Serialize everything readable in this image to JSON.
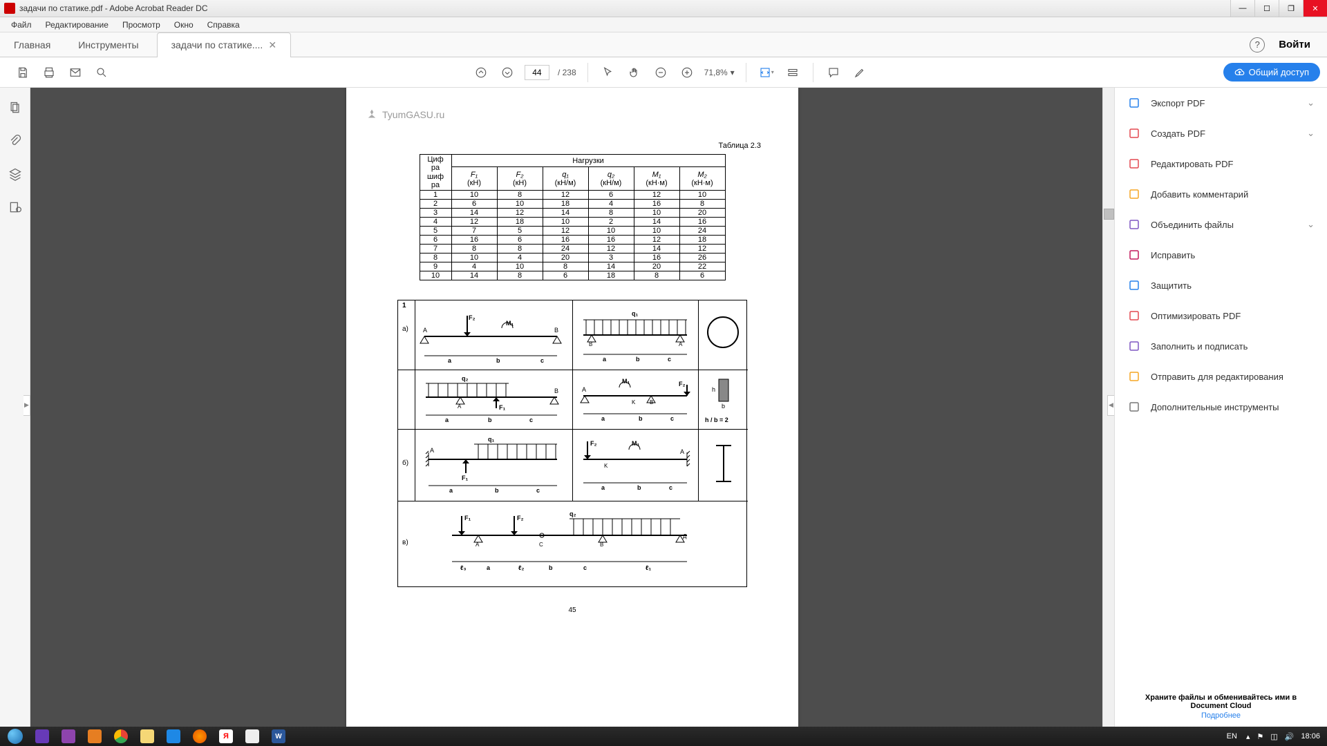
{
  "titlebar": {
    "text": "задачи по статике.pdf - Adobe Acrobat Reader DC"
  },
  "menu": [
    "Файл",
    "Редактирование",
    "Просмотр",
    "Окно",
    "Справка"
  ],
  "tabs": {
    "home": "Главная",
    "tools": "Инструменты",
    "doc": "задачи по статике...."
  },
  "login": "Войти",
  "toolbar": {
    "page": "44",
    "total": "/ 238",
    "zoom": "71,8%",
    "share": "Общий доступ"
  },
  "page": {
    "watermark": "TyumGASU.ru",
    "table_caption": "Таблица 2.3",
    "num": "45",
    "table": {
      "h0": "Циф\nра\nшиф\nра",
      "h_nagr": "Нагрузки",
      "cols": [
        {
          "sym": "F₁",
          "unit": "(кН)"
        },
        {
          "sym": "F₂",
          "unit": "(кН)"
        },
        {
          "sym": "q₁",
          "unit": "(кН/м)"
        },
        {
          "sym": "q₂",
          "unit": "(кН/м)"
        },
        {
          "sym": "M₁",
          "unit": "(кН·м)"
        },
        {
          "sym": "M₂",
          "unit": "(кН·м)"
        }
      ],
      "rows": [
        [
          "1",
          "10",
          "8",
          "12",
          "6",
          "12",
          "10"
        ],
        [
          "2",
          "6",
          "10",
          "18",
          "4",
          "16",
          "8"
        ],
        [
          "3",
          "14",
          "12",
          "14",
          "8",
          "10",
          "20"
        ],
        [
          "4",
          "12",
          "18",
          "10",
          "2",
          "14",
          "16"
        ],
        [
          "5",
          "7",
          "5",
          "12",
          "10",
          "10",
          "24"
        ],
        [
          "6",
          "16",
          "6",
          "16",
          "16",
          "12",
          "18"
        ],
        [
          "7",
          "8",
          "8",
          "24",
          "12",
          "14",
          "12"
        ],
        [
          "8",
          "10",
          "4",
          "20",
          "3",
          "16",
          "26"
        ],
        [
          "9",
          "4",
          "10",
          "8",
          "14",
          "20",
          "22"
        ],
        [
          "10",
          "14",
          "8",
          "6",
          "18",
          "8",
          "6"
        ]
      ]
    },
    "figure": {
      "variant": "1",
      "row_labels": [
        "а)",
        "",
        "б)",
        "в)"
      ],
      "sect_ratio": "h / b = 2"
    }
  },
  "right": {
    "items": [
      {
        "label": "Экспорт PDF",
        "color": "#2680eb",
        "chevron": true
      },
      {
        "label": "Создать PDF",
        "color": "#e34850",
        "chevron": true
      },
      {
        "label": "Редактировать PDF",
        "color": "#e34850"
      },
      {
        "label": "Добавить комментарий",
        "color": "#f5a623"
      },
      {
        "label": "Объединить файлы",
        "color": "#7e57c2",
        "chevron": true
      },
      {
        "label": "Исправить",
        "color": "#c2185b"
      },
      {
        "label": "Защитить",
        "color": "#2680eb"
      },
      {
        "label": "Оптимизировать PDF",
        "color": "#e34850"
      },
      {
        "label": "Заполнить и подписать",
        "color": "#7e57c2"
      },
      {
        "label": "Отправить для редактирования",
        "color": "#f5a623"
      },
      {
        "label": "Дополнительные инструменты",
        "color": "#777"
      }
    ],
    "promo": {
      "line1": "Храните файлы и обменивайтесь ими в",
      "line2": "Document Cloud",
      "link": "Подробнее"
    }
  },
  "taskbar": {
    "lang": "EN",
    "time": "18:06"
  }
}
